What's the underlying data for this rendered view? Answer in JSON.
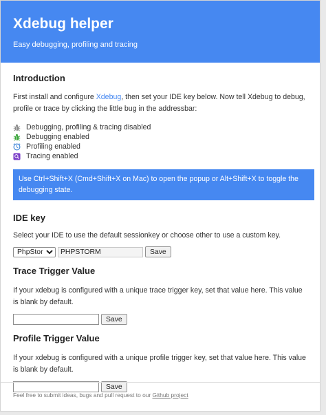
{
  "header": {
    "title": "Xdebug helper",
    "subtitle": "Easy debugging, profiling and tracing"
  },
  "introduction": {
    "heading": "Introduction",
    "text_before_link": "First install and configure ",
    "link_text": "Xdebug",
    "text_after_link": ", then set your IDE key below. Now tell Xdebug to debug, profile or trace by clicking the little bug in the addressbar:",
    "states": [
      {
        "icon": "bug-gray-icon",
        "label": "Debugging, profiling & tracing disabled",
        "color": "#8a8a8a"
      },
      {
        "icon": "bug-green-icon",
        "label": "Debugging enabled",
        "color": "#3aa53a"
      },
      {
        "icon": "clock-icon",
        "label": "Profiling enabled",
        "color": "#3f86d8"
      },
      {
        "icon": "magnifier-icon",
        "label": "Tracing enabled",
        "color": "#7b3fc8"
      }
    ],
    "shortcut_banner": "Use Ctrl+Shift+X (Cmd+Shift+X on Mac) to open the popup or Alt+Shift+X to toggle the debugging state."
  },
  "ide_key": {
    "heading": "IDE key",
    "description": "Select your IDE to use the default sessionkey or choose other to use a custom key.",
    "selected_ide": "PhpStorm",
    "key_value": "PHPSTORM",
    "save_label": "Save"
  },
  "trace_trigger": {
    "heading": "Trace Trigger Value",
    "description": "If your xdebug is configured with a unique trace trigger key, set that value here. This value is blank by default.",
    "value": "",
    "save_label": "Save"
  },
  "profile_trigger": {
    "heading": "Profile Trigger Value",
    "description": "If your xdebug is configured with a unique profile trigger key, set that value here. This value is blank by default.",
    "value": "",
    "save_label": "Save"
  },
  "footer": {
    "text": "Feel free to submit ideas, bugs and pull request to our ",
    "link_text": "Github project"
  },
  "colors": {
    "accent": "#4688f1"
  }
}
